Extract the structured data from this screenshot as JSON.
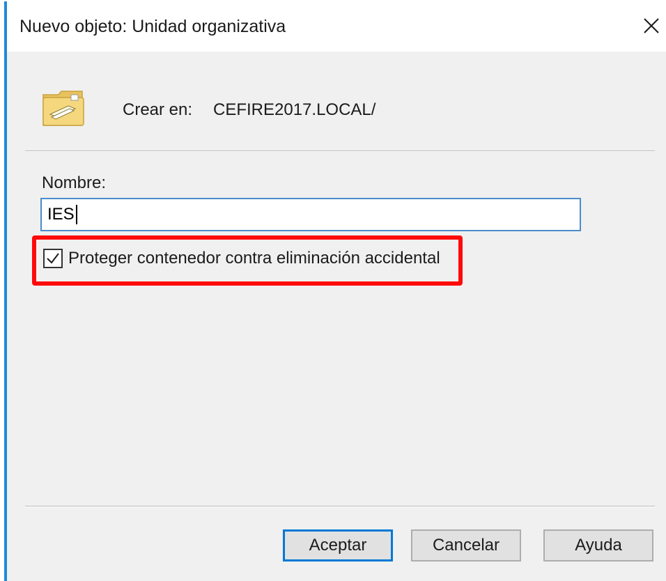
{
  "window": {
    "title": "Nuevo objeto: Unidad organizativa"
  },
  "header": {
    "icon": "organizational-unit-folder-icon",
    "create_label": "Crear en:",
    "create_path": "CEFIRE2017.LOCAL/"
  },
  "form": {
    "name_label": "Nombre:",
    "name_value": "IES",
    "protect_checkbox": {
      "label": "Proteger contenedor contra eliminación accidental",
      "checked": true
    }
  },
  "buttons": {
    "accept": "Aceptar",
    "cancel": "Cancelar",
    "help": "Ayuda"
  },
  "colors": {
    "accent": "#0078d7",
    "highlight": "#ff0a0a"
  }
}
